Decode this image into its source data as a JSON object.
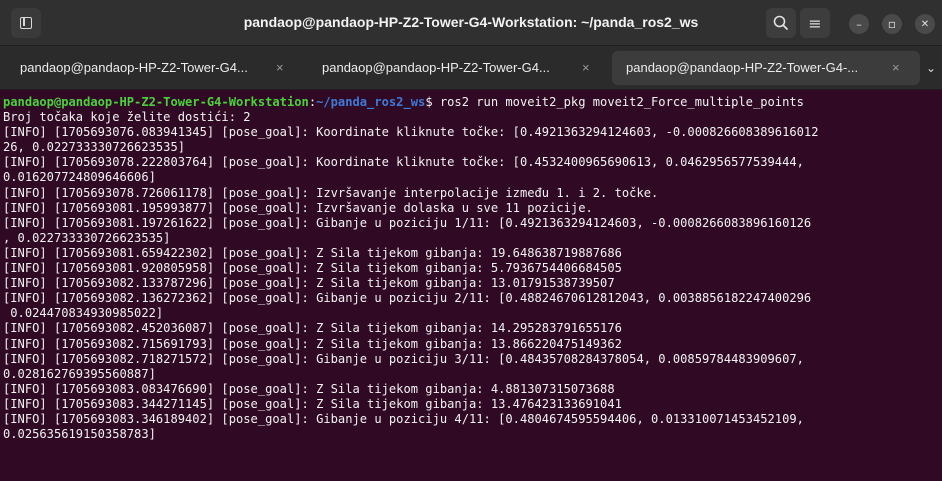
{
  "window": {
    "title": "pandaop@pandaop-HP-Z2-Tower-G4-Workstation: ~/panda_ros2_ws",
    "menu_glyph": "≡",
    "minimize_glyph": "–",
    "maximize_glyph": "▫",
    "close_glyph": "✕"
  },
  "tabs": [
    {
      "label": "pandaop@pandaop-HP-Z2-Tower-G4...",
      "close": "×",
      "active": false
    },
    {
      "label": "pandaop@pandaop-HP-Z2-Tower-G4...",
      "close": "×",
      "active": false
    },
    {
      "label": "pandaop@pandaop-HP-Z2-Tower-G4-...",
      "close": "×",
      "active": true
    }
  ],
  "tab_dropdown_glyph": "⌄",
  "terminal": {
    "prompt_user": "pandaop@pandaop-HP-Z2-Tower-G4-Workstation",
    "prompt_sep": ":",
    "prompt_path": "~/panda_ros2_ws",
    "prompt_dollar": "$ ",
    "command": "ros2 run moveit2_pkg moveit2_Force_multiple_points",
    "lines": [
      "Broj točaka koje želite dostići: 2",
      "[INFO] [1705693076.083941345] [pose_goal]: Koordinate kliknute točke: [0.4921363294124603, -0.000826608389616012",
      "26, 0.022733330726623535]",
      "[INFO] [1705693078.222803764] [pose_goal]: Koordinate kliknute točke: [0.4532400965690613, 0.0462956577539444,",
      "0.016207724809646606]",
      "[INFO] [1705693078.726061178] [pose_goal]: Izvršavanje interpolacije između 1. i 2. točke.",
      "[INFO] [1705693081.195993877] [pose_goal]: Izvršavanje dolaska u sve 11 pozicije.",
      "[INFO] [1705693081.197261622] [pose_goal]: Gibanje u poziciju 1/11: [0.4921363294124603, -0.0008266083896160126",
      ", 0.022733330726623535]",
      "[INFO] [1705693081.659422302] [pose_goal]: Z Sila tijekom gibanja: 19.648638719887686",
      "[INFO] [1705693081.920805958] [pose_goal]: Z Sila tijekom gibanja: 5.7936754406684505",
      "[INFO] [1705693082.133787296] [pose_goal]: Z Sila tijekom gibanja: 13.01791538739507",
      "[INFO] [1705693082.136272362] [pose_goal]: Gibanje u poziciju 2/11: [0.48824670612812043, 0.0038856182247400296",
      " 0.024470834930985022]",
      "[INFO] [1705693082.452036087] [pose_goal]: Z Sila tijekom gibanja: 14.295283791655176",
      "[INFO] [1705693082.715691793] [pose_goal]: Z Sila tijekom gibanja: 13.866220475149362",
      "[INFO] [1705693082.718271572] [pose_goal]: Gibanje u poziciju 3/11: [0.48435708284378054, 0.00859784483909607,",
      "0.028162769395560887]",
      "[INFO] [1705693083.083476690] [pose_goal]: Z Sila tijekom gibanja: 4.881307315073688",
      "[INFO] [1705693083.344271145] [pose_goal]: Z Sila tijekom gibanja: 13.476423133691041",
      "[INFO] [1705693083.346189402] [pose_goal]: Gibanje u poziciju 4/11: [0.4804674595594406, 0.013310071453452109,",
      "0.025635619150358783]"
    ]
  }
}
